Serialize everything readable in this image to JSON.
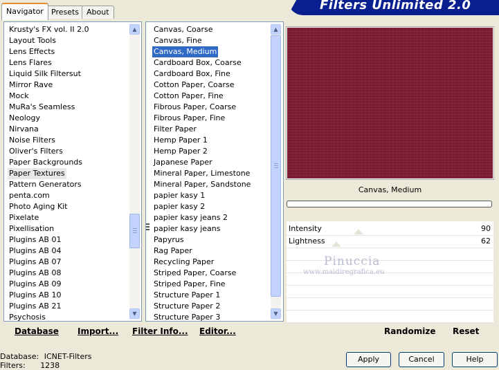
{
  "tabs": [
    "Navigator",
    "Presets",
    "About"
  ],
  "app_title": "Filters Unlimited 2.0",
  "categories": {
    "items": [
      "Krusty's FX vol. II 2.0",
      "Layout Tools",
      "Lens Effects",
      "Lens Flares",
      "Liquid Silk Filtersut",
      "Mirror Rave",
      "Mock",
      "MuRa's Seamless",
      "Neology",
      "Nirvana",
      "Noise Filters",
      "Oliver's Filters",
      "Paper Backgrounds",
      "Paper Textures",
      "Pattern Generators",
      "penta.com",
      "Photo Aging Kit",
      "Pixelate",
      "Pixellisation",
      "Plugins AB 01",
      "Plugins AB 04",
      "Plugins AB 07",
      "Plugins AB 08",
      "Plugins AB 09",
      "Plugins AB 10",
      "Plugins AB 21",
      "Psychosis"
    ],
    "selected": "Paper Textures"
  },
  "filters": {
    "items": [
      "Canvas, Coarse",
      "Canvas, Fine",
      "Canvas, Medium",
      "Cardboard Box, Coarse",
      "Cardboard Box, Fine",
      "Cotton Paper, Coarse",
      "Cotton Paper, Fine",
      "Fibrous Paper, Coarse",
      "Fibrous Paper, Fine",
      "Filter Paper",
      "Hemp Paper 1",
      "Hemp Paper 2",
      "Japanese Paper",
      "Mineral Paper, Limestone",
      "Mineral Paper, Sandstone",
      "papier kasy 1",
      "papier kasy 2",
      "papier kasy jeans 2",
      "papier kasy jeans",
      "Papyrus",
      "Rag Paper",
      "Recycling Paper",
      "Striped Paper, Coarse",
      "Striped Paper, Fine",
      "Structure Paper 1",
      "Structure Paper 2",
      "Structure Paper 3"
    ],
    "selected": "Canvas, Medium"
  },
  "left_buttons": {
    "database": "Database",
    "import": "Import...",
    "filter_info": "Filter Info...",
    "editor": "Editor..."
  },
  "preview": {
    "color": "#7c1c34",
    "filter_name": "Canvas, Medium"
  },
  "params": [
    {
      "label": "Intensity",
      "value": "90",
      "fraction": 0.35
    },
    {
      "label": "Lightness",
      "value": "62",
      "fraction": 0.243
    }
  ],
  "watermark": {
    "name": "Pinuccia",
    "url": "www.maidiregrafica.eu"
  },
  "right_buttons": {
    "randomize": "Randomize",
    "reset": "Reset"
  },
  "status": {
    "database_label": "Database:",
    "database_value": "ICNET-Filters",
    "filters_label": "Filters:",
    "filters_value": "1238"
  },
  "dialog_buttons": {
    "apply": "Apply",
    "cancel": "Cancel",
    "help": "Help"
  }
}
